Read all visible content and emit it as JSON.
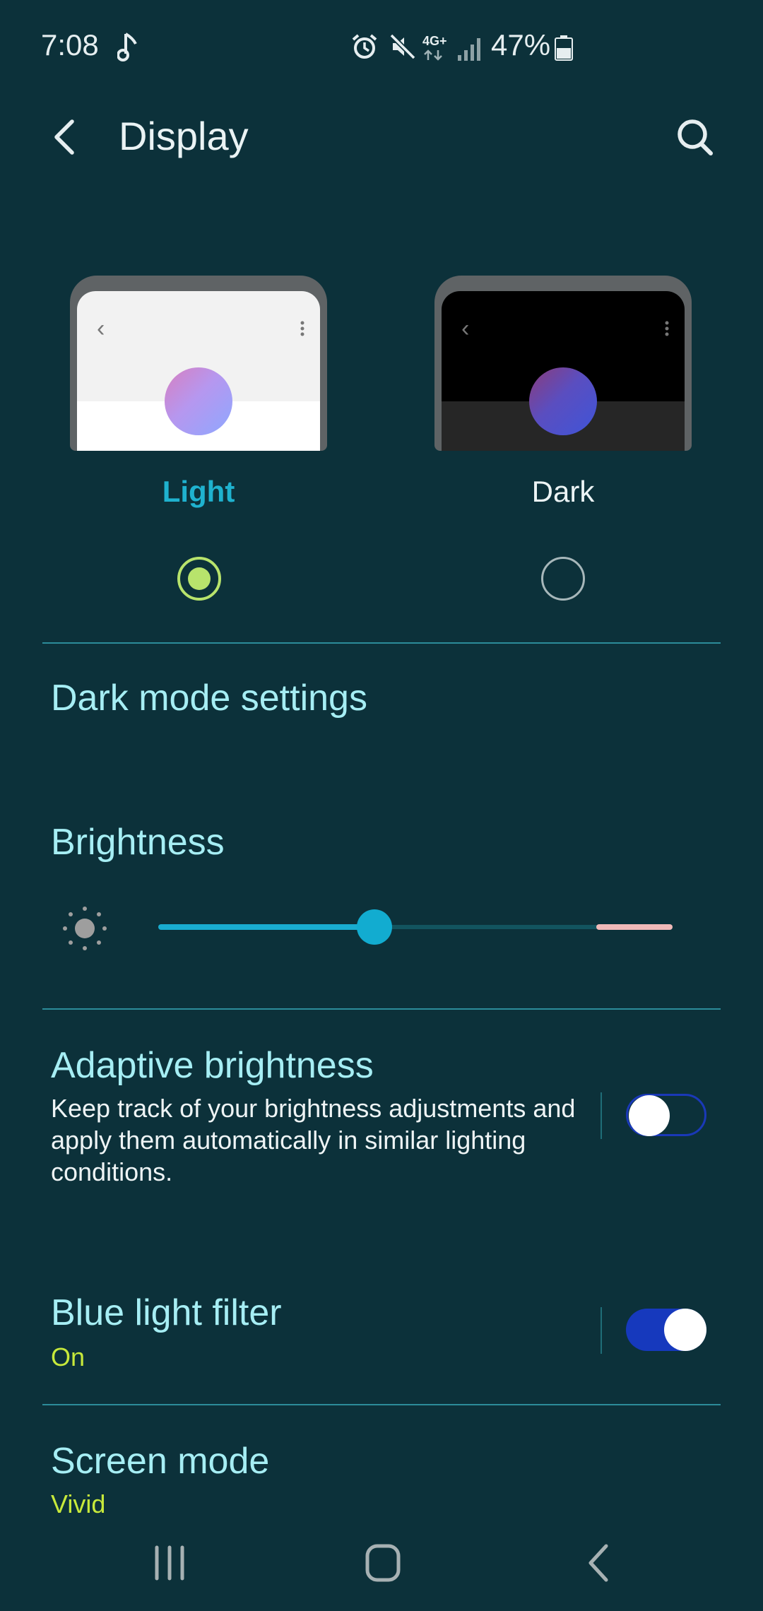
{
  "status_bar": {
    "time": "7:08",
    "network": "4G+",
    "battery": "47%",
    "icons": [
      "music-note-icon",
      "alarm-icon",
      "mute-icon",
      "network-4g-icon",
      "signal-icon",
      "battery-icon"
    ]
  },
  "header": {
    "title": "Display"
  },
  "theme": {
    "options": [
      {
        "label": "Light",
        "selected": true
      },
      {
        "label": "Dark",
        "selected": false
      }
    ]
  },
  "dark_mode_settings": {
    "label": "Dark mode settings"
  },
  "brightness": {
    "label": "Brightness",
    "level": 0.42
  },
  "adaptive_brightness": {
    "label": "Adaptive brightness",
    "description": "Keep track of your brightness adjustments and apply them automatically in similar lighting conditions.",
    "enabled": false
  },
  "blue_light_filter": {
    "label": "Blue light filter",
    "status": "On",
    "enabled": true
  },
  "screen_mode": {
    "label": "Screen mode",
    "value": "Vivid"
  },
  "colors": {
    "background": "#0c313a",
    "accent": "#1fb2cf",
    "title_text": "#a6eef4",
    "status_text": "#c7e93b",
    "toggle_on": "#1639bd"
  }
}
